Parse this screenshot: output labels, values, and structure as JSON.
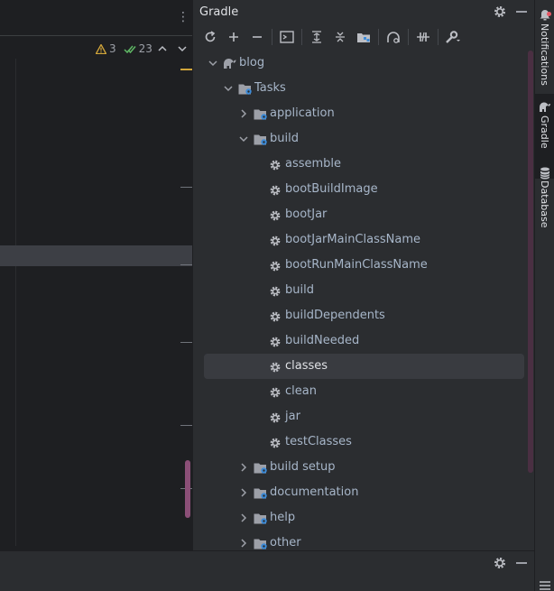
{
  "editor": {
    "kebab_icon": "more-vertical-icon",
    "inspections": {
      "warnings": "3",
      "passed": "23",
      "warning_color": "#d0a43a",
      "passed_color": "#5fb865"
    }
  },
  "gradle": {
    "title": "Gradle",
    "toolbar": [
      {
        "icon": "reload-icon"
      },
      {
        "icon": "plus-icon"
      },
      {
        "icon": "minus-icon"
      },
      {
        "icon": "execute-task-icon"
      },
      {
        "icon": "expand-all-icon"
      },
      {
        "icon": "collapse-all-icon"
      },
      {
        "icon": "group-modules-icon"
      },
      {
        "icon": "analyze-dependencies-icon"
      },
      {
        "icon": "toggle-offline-icon"
      },
      {
        "icon": "build-tool-settings-icon"
      }
    ],
    "tree": {
      "project": "blog",
      "tasks_label": "Tasks",
      "groups_before": [
        {
          "label": "application",
          "expanded": false
        }
      ],
      "build_group": {
        "label": "build",
        "tasks": [
          "assemble",
          "bootBuildImage",
          "bootJar",
          "bootJarMainClassName",
          "bootRunMainClassName",
          "build",
          "buildDependents",
          "buildNeeded",
          "classes",
          "clean",
          "jar",
          "testClasses"
        ],
        "selected": "classes"
      },
      "groups_after": [
        {
          "label": "build setup"
        },
        {
          "label": "documentation"
        },
        {
          "label": "help"
        },
        {
          "label": "other"
        }
      ]
    }
  },
  "strip": {
    "notifications": "Notifications",
    "gradle": "Gradle",
    "database": "Database"
  },
  "colors": {
    "accent_folder": "#6a9fd8",
    "selection": "#393b40",
    "panel_bg": "#2b2d30",
    "editor_bg": "#1e1f22"
  }
}
